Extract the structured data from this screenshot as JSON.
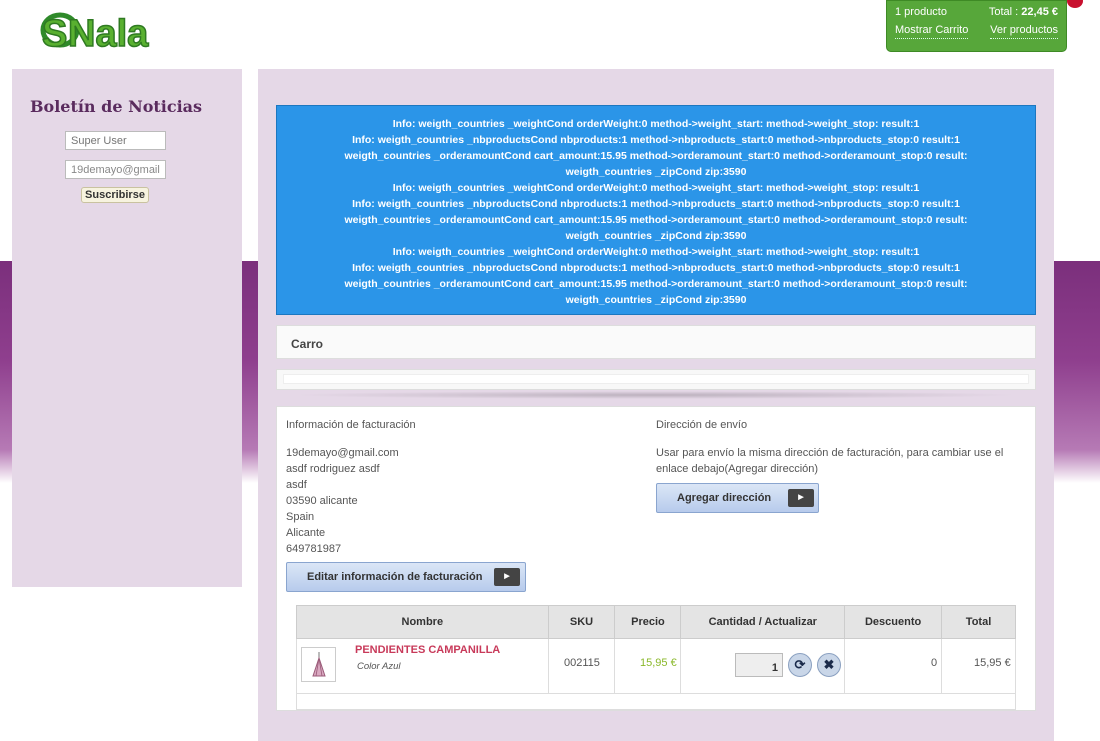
{
  "brand": {
    "logo_text": "SNala"
  },
  "cart": {
    "count": "1 producto",
    "total_label": "Total :",
    "total_value": "22,45 €",
    "show_cart": "Mostrar Carrito",
    "view_products": "Ver productos"
  },
  "newsletter": {
    "title": "Boletín de Noticias",
    "name_placeholder": "Super User",
    "email_value": "19demayo@gmail",
    "subscribe": "Suscribirse"
  },
  "info_messages": [
    "Info: weigth_countries _weightCond orderWeight:0 method->weight_start: method->weight_stop: result:1",
    "Info: weigth_countries _nbproductsCond nbproducts:1 method->nbproducts_start:0 method->nbproducts_stop:0 result:1",
    "weigth_countries _orderamountCond cart_amount:15.95 method->orderamount_start:0 method->orderamount_stop:0 result:",
    "weigth_countries _zipCond zip:3590",
    "Info: weigth_countries _weightCond orderWeight:0 method->weight_start: method->weight_stop: result:1",
    "Info: weigth_countries _nbproductsCond nbproducts:1 method->nbproducts_start:0 method->nbproducts_stop:0 result:1",
    "weigth_countries _orderamountCond cart_amount:15.95 method->orderamount_start:0 method->orderamount_stop:0 result:",
    "weigth_countries _zipCond zip:3590",
    "Info: weigth_countries _weightCond orderWeight:0 method->weight_start: method->weight_stop: result:1",
    "Info: weigth_countries _nbproductsCond nbproducts:1 method->nbproducts_start:0 method->nbproducts_stop:0 result:1",
    "weigth_countries _orderamountCond cart_amount:15.95 method->orderamount_start:0 method->orderamount_stop:0 result:",
    "weigth_countries _zipCond zip:3590"
  ],
  "cart_page": {
    "title": "Carro"
  },
  "billing": {
    "title": "Información de facturación",
    "lines": [
      "19demayo@gmail.com",
      "asdf rodriguez asdf",
      "asdf",
      "03590 alicante",
      "Spain",
      "Alicante",
      "649781987"
    ],
    "edit_button": "Editar información de facturación"
  },
  "shipping": {
    "title": "Dirección de envío",
    "description": "Usar para envío la misma dirección de facturación, para cambiar use el enlace debajo(Agregar dirección)",
    "add_button": "Agregar dirección"
  },
  "table": {
    "headers": [
      "Nombre",
      "SKU",
      "Precio",
      "Cantidad / Actualizar",
      "Descuento",
      "Total"
    ],
    "row": {
      "name": "PENDIENTES CAMPANILLA",
      "attribute": "Color Azul",
      "sku": "002115",
      "price": "15,95 €",
      "quantity": "1",
      "discount": "0",
      "total": "15,95 €"
    }
  },
  "colors": {
    "info_bg": "#2b95e8",
    "cart_green": "#57a73a",
    "product_name": "#c83a5a",
    "price_green": "#8ab82a"
  },
  "icons": {
    "update": "refresh-icon",
    "delete": "close-icon",
    "arrow": "play-arrow-icon"
  }
}
